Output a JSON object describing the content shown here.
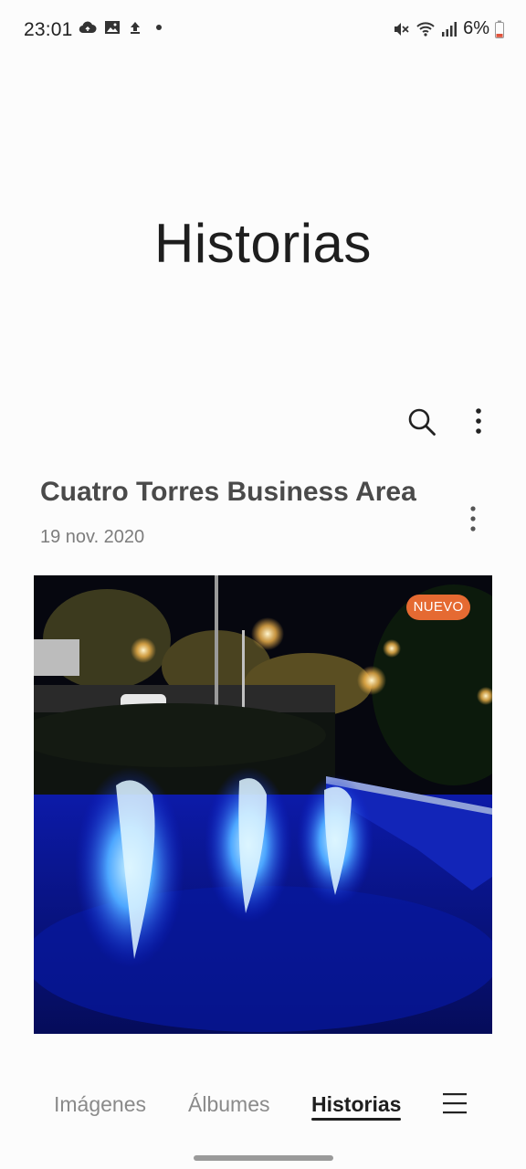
{
  "status_bar": {
    "time": "23:01",
    "battery_percent": "6%",
    "left_icons": [
      "cloud-sync-icon",
      "image-icon",
      "upload-icon",
      "dot-icon"
    ],
    "right_icons": [
      "mute-vibrate-icon",
      "wifi-calling-icon",
      "signal-icon",
      "battery-low-icon"
    ]
  },
  "header": {
    "title": "Historias",
    "search_icon": "search-icon",
    "more_icon": "more-vertical-icon"
  },
  "story": {
    "title": "Cuatro Torres Business Area",
    "date": "19 nov. 2020",
    "badge": "NUEVO",
    "badge_color": "#e56a32",
    "cover_description_icon": "fountain-photo"
  },
  "bottom_nav": {
    "tabs": [
      {
        "label": "Imágenes",
        "active": false
      },
      {
        "label": "Álbumes",
        "active": false
      },
      {
        "label": "Historias",
        "active": true
      }
    ],
    "menu_icon": "hamburger-menu-icon"
  },
  "colors": {
    "background": "#fcfcfc",
    "accent_badge": "#e56a32",
    "text_primary": "#1e1e1e",
    "text_secondary": "#7d7d7d"
  }
}
